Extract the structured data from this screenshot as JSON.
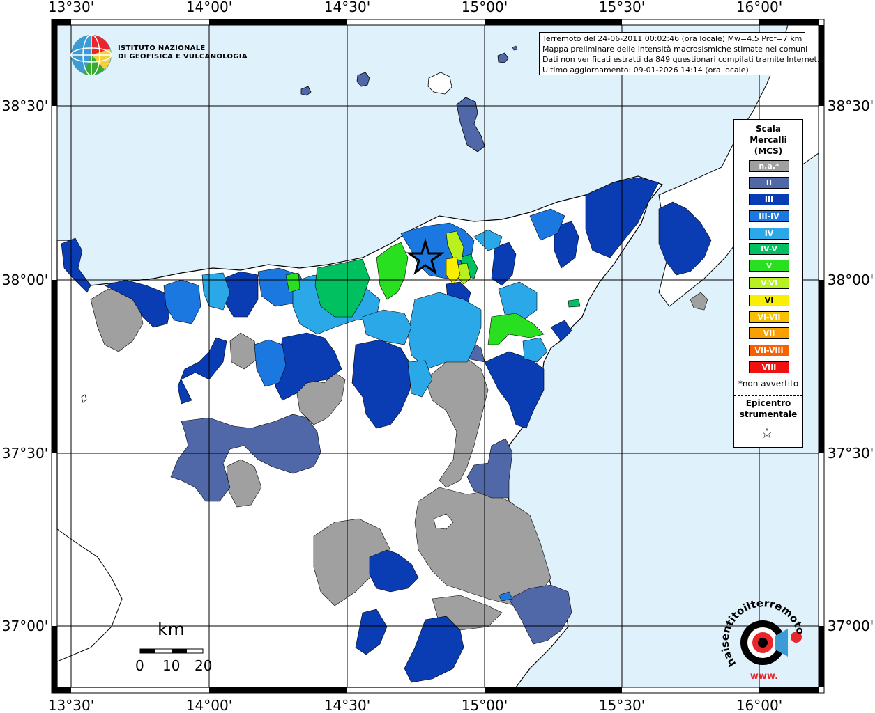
{
  "info_box": {
    "line1": "Terremoto del 24-06-2011 00:02:46 (ora locale) Mw=4.5 Prof=7 km",
    "line2": "Mappa preliminare delle intensità macrosismiche stimate nei comuni",
    "line3": "Dati non verificati estratti da 849 questionari compilati tramite Internet.",
    "line4": "Ultimo aggiornamento: 09-01-2026 14:14 (ora locale)"
  },
  "logo": {
    "line1": "ISTITUTO NAZIONALE",
    "line2": "DI GEOFISICA E VULCANOLOGIA",
    "colors": [
      "#3a9bd5",
      "#e9262b",
      "#3aaa35",
      "#f3d03e"
    ]
  },
  "axes": {
    "longitude_top": [
      "13°30'",
      "14°00'",
      "14°30'",
      "15°00'",
      "15°30'",
      "16°00'"
    ],
    "longitude_bottom": [
      "13°30'",
      "14°00'",
      "14°30'",
      "15°00'",
      "15°30'",
      "16°00'"
    ],
    "latitude_left": [
      "38°30'",
      "38°00'",
      "37°30'",
      "37°00'"
    ],
    "latitude_right": [
      "38°30'",
      "38°00'",
      "37°30'",
      "37°00'"
    ]
  },
  "legend": {
    "title_line1": "Scala",
    "title_line2": "Mercalli",
    "title_line3": "(MCS)",
    "items": [
      {
        "label": "n.a.*",
        "color": "#a0a0a0"
      },
      {
        "label": "II",
        "color": "#5068a8"
      },
      {
        "label": "III",
        "color": "#0a3db4"
      },
      {
        "label": "III-IV",
        "color": "#1a78e0"
      },
      {
        "label": "IV",
        "color": "#2aa8e8"
      },
      {
        "label": "IV-V",
        "color": "#00c060"
      },
      {
        "label": "V",
        "color": "#28e020"
      },
      {
        "label": "V-VI",
        "color": "#b8f020"
      },
      {
        "label": "VI",
        "color": "#f8f000"
      },
      {
        "label": "VI-VII",
        "color": "#f8c000"
      },
      {
        "label": "VII",
        "color": "#f8a000"
      },
      {
        "label": "VII-VIII",
        "color": "#f86000"
      },
      {
        "label": "VIII",
        "color": "#f01010"
      }
    ],
    "note": "*non avvertito",
    "epicenter_line1": "Epicentro",
    "epicenter_line2": "strumentale",
    "epicenter_symbol": "☆"
  },
  "scale_bar": {
    "unit": "km",
    "ticks": [
      "0",
      "10",
      "20"
    ]
  },
  "watermark": {
    "text": "haisentitoilterremoto.it",
    "url_text": "www."
  },
  "colors": {
    "sea": "#dff1fb",
    "land_unsampled": "#ffffff",
    "coast": "#000000"
  }
}
